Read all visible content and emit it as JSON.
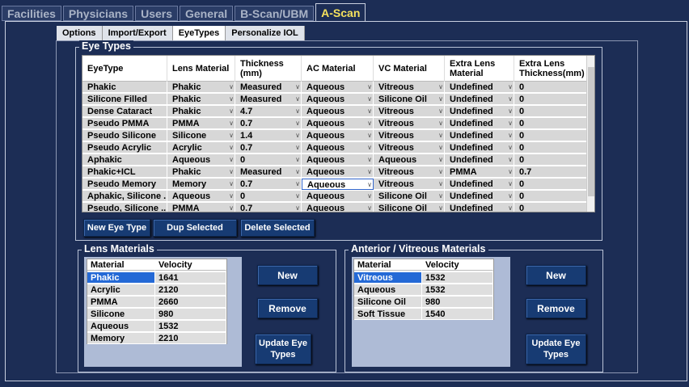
{
  "top_tabs": [
    "Facilities",
    "Physicians",
    "Users",
    "General",
    "B-Scan/UBM",
    "A-Scan"
  ],
  "sub_tabs": [
    "Options",
    "Import/Export",
    "EyeTypes",
    "Personalize IOL"
  ],
  "eye_types": {
    "title": "Eye Types",
    "headers": [
      "EyeType",
      "Lens Material",
      "Thickness (mm)",
      "AC Material",
      "VC Material",
      "Extra Lens Material",
      "Extra Lens Thickness(mm)"
    ],
    "rows": [
      [
        "Phakic",
        "Phakic",
        "Measured",
        "Aqueous",
        "Vitreous",
        "Undefined",
        "0"
      ],
      [
        "Silicone Filled",
        "Phakic",
        "Measured",
        "Aqueous",
        "Silicone Oil",
        "Undefined",
        "0"
      ],
      [
        "Dense Cataract",
        "Phakic",
        "4.7",
        "Aqueous",
        "Vitreous",
        "Undefined",
        "0"
      ],
      [
        "Pseudo PMMA",
        "PMMA",
        "0.7",
        "Aqueous",
        "Vitreous",
        "Undefined",
        "0"
      ],
      [
        "Pseudo Silicone",
        "Silicone",
        "1.4",
        "Aqueous",
        "Vitreous",
        "Undefined",
        "0"
      ],
      [
        "Pseudo Acrylic",
        "Acrylic",
        "0.7",
        "Aqueous",
        "Vitreous",
        "Undefined",
        "0"
      ],
      [
        "Aphakic",
        "Aqueous",
        "0",
        "Aqueous",
        "Aqueous",
        "Undefined",
        "0"
      ],
      [
        "Phakic+ICL",
        "Phakic",
        "Measured",
        "Aqueous",
        "Vitreous",
        "PMMA",
        "0.7"
      ],
      [
        "Pseudo Memory",
        "Memory",
        "0.7",
        "Aqueous",
        "Vitreous",
        "Undefined",
        "0"
      ],
      [
        "Aphakic, Silicone ...",
        "Aqueous",
        "0",
        "Aqueous",
        "Silicone Oil",
        "Undefined",
        "0"
      ],
      [
        "Pseudo, Silicone ...",
        "PMMA",
        "0.7",
        "Aqueous",
        "Silicone Oil",
        "Undefined",
        "0"
      ]
    ],
    "buttons": {
      "new": "New Eye Type",
      "dup": "Dup Selected",
      "delete": "Delete Selected"
    }
  },
  "lens_materials": {
    "title": "Lens Materials",
    "headers": [
      "Material",
      "Velocity"
    ],
    "rows": [
      [
        "Phakic",
        "1641"
      ],
      [
        "Acrylic",
        "2120"
      ],
      [
        "PMMA",
        "2660"
      ],
      [
        "Silicone",
        "980"
      ],
      [
        "Aqueous",
        "1532"
      ],
      [
        "Memory",
        "2210"
      ]
    ],
    "buttons": {
      "new": "New",
      "remove": "Remove",
      "update": "Update Eye Types"
    }
  },
  "av_materials": {
    "title": "Anterior / Vitreous Materials",
    "headers": [
      "Material",
      "Velocity"
    ],
    "rows": [
      [
        "Vitreous",
        "1532"
      ],
      [
        "Aqueous",
        "1532"
      ],
      [
        "Silicone Oil",
        "980"
      ],
      [
        "Soft Tissue",
        "1540"
      ]
    ],
    "buttons": {
      "new": "New",
      "remove": "Remove",
      "update": "Update  Eye Types"
    }
  }
}
